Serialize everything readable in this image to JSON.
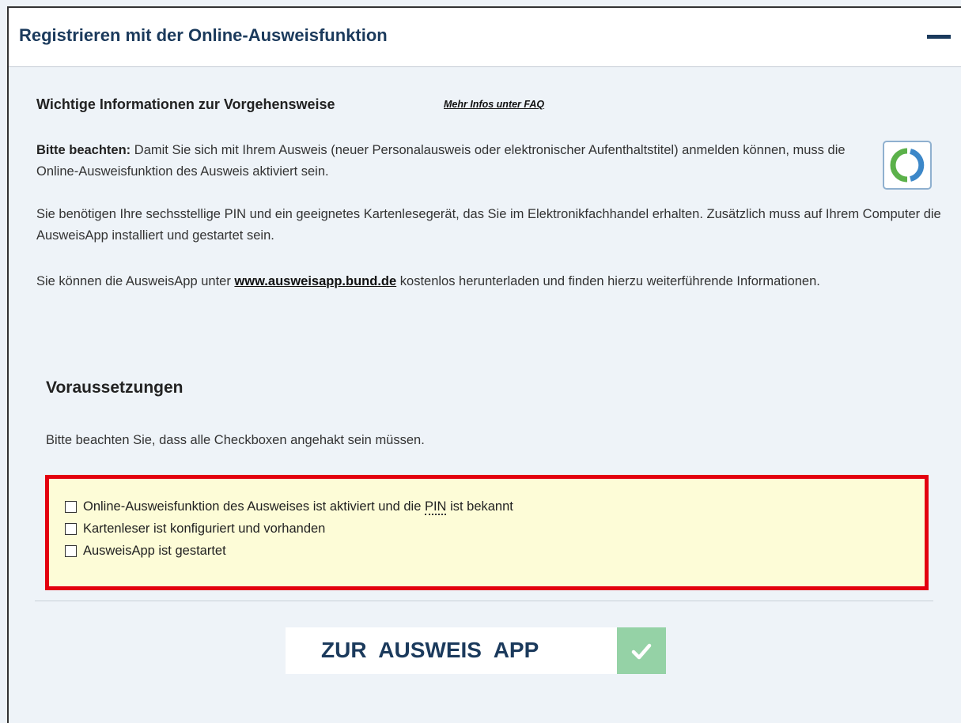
{
  "header": {
    "title": "Registrieren mit der Online-Ausweisfunktion",
    "collapse_icon": "minus-icon"
  },
  "info": {
    "heading": "Wichtige Informationen zur Vorgehensweise",
    "faq_link": "Mehr Infos unter FAQ",
    "notice_label": "Bitte beachten:",
    "notice_text": " Damit Sie sich mit Ihrem Ausweis (neuer Personalausweis oder elektronischer Aufenthaltstitel) anmelden können, muss die Online-Ausweisfunktion des Ausweis aktiviert sein.",
    "requirements_text": "Sie benötigen Ihre sechsstellige PIN und ein geeignetes Kartenlesegerät, das Sie im Elektronikfachhandel erhalten. Zusätzlich muss auf Ihrem Computer die AusweisApp installiert und gestartet sein.",
    "download_prefix": "Sie können die AusweisApp unter ",
    "download_link": "www.ausweisapp.bund.de",
    "download_suffix": " kostenlos herunterladen und finden hierzu weiterführende Informationen.",
    "app_icon": "ausweisapp-logo-icon"
  },
  "prerequisites": {
    "heading": "Voraussetzungen",
    "hint": "Bitte beachten Sie, dass alle Checkboxen angehakt sein müssen.",
    "items": [
      {
        "before": "Online-Ausweisfunktion des Ausweises ist aktiviert und die ",
        "abbr": "PIN",
        "after": " ist bekannt",
        "checked": false
      },
      {
        "label": "Kartenleser ist konfiguriert und vorhanden",
        "checked": false
      },
      {
        "label": "AusweisApp ist gestartet",
        "checked": false
      }
    ],
    "highlight_border_color": "#e3000f",
    "highlight_background": "#fdfcd7"
  },
  "action": {
    "label": "ZUR AUSWEIS APP",
    "icon": "checkmark-icon",
    "icon_background": "#95d2a6"
  },
  "colors": {
    "header_text": "#1b3a5c",
    "page_background": "#eef3f8"
  }
}
